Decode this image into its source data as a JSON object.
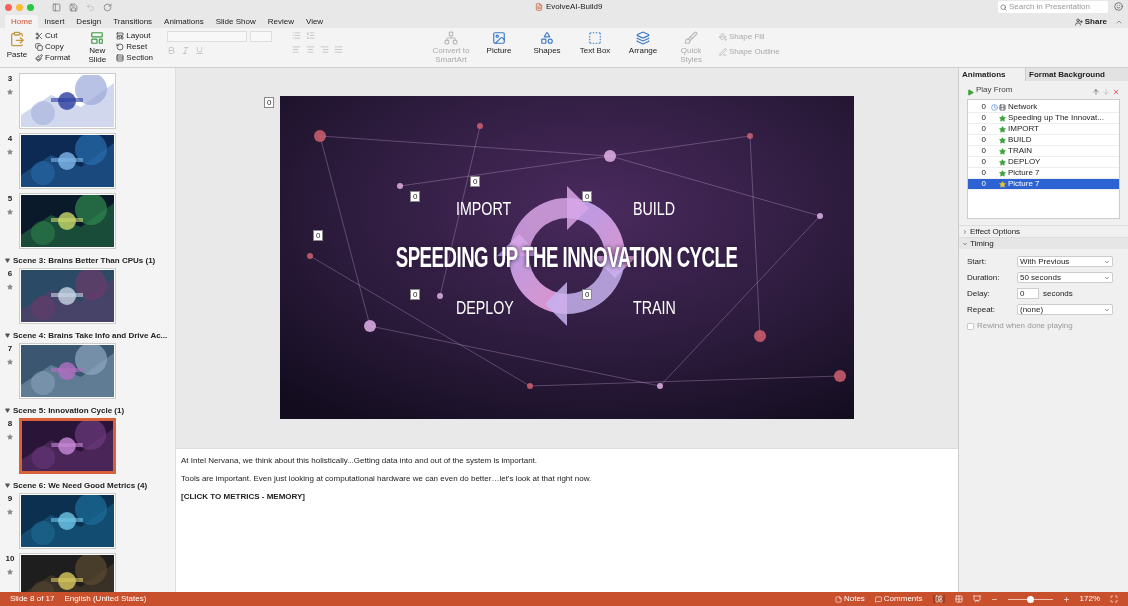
{
  "window": {
    "title": "EvolveAI-Build9"
  },
  "search": {
    "placeholder": "Search in Presentation"
  },
  "share": "Share",
  "tabs": [
    {
      "label": "Home",
      "selected": true
    },
    {
      "label": "Insert",
      "selected": false
    },
    {
      "label": "Design",
      "selected": false
    },
    {
      "label": "Transitions",
      "selected": false
    },
    {
      "label": "Animations",
      "selected": false
    },
    {
      "label": "Slide Show",
      "selected": false
    },
    {
      "label": "Review",
      "selected": false
    },
    {
      "label": "View",
      "selected": false
    }
  ],
  "ribbon": {
    "paste": "Paste",
    "clipboard": [
      "Cut",
      "Copy",
      "Format"
    ],
    "new_slide": "New Slide",
    "slide_tools": [
      "Layout",
      "Reset",
      "Section"
    ],
    "insert": [
      {
        "label": "Convert to SmartArt",
        "kind": "smartart",
        "disabled": true
      },
      {
        "label": "Picture",
        "kind": "picture",
        "disabled": false
      },
      {
        "label": "Shapes",
        "kind": "shapes",
        "disabled": false
      },
      {
        "label": "Text Box",
        "kind": "textbox",
        "disabled": false
      },
      {
        "label": "Arrange",
        "kind": "arrange",
        "disabled": false
      },
      {
        "label": "Quick Styles",
        "kind": "styles",
        "disabled": true
      }
    ],
    "shape_format": [
      "Shape Fill",
      "Shape Outline"
    ]
  },
  "thumbnails": [
    {
      "kind": "slide",
      "number": "3",
      "selected": false
    },
    {
      "kind": "slide",
      "number": "4",
      "selected": false
    },
    {
      "kind": "slide",
      "number": "5",
      "selected": false
    },
    {
      "kind": "section",
      "label": "Scene 3: Brains Better Than CPUs (1)"
    },
    {
      "kind": "slide",
      "number": "6",
      "selected": false
    },
    {
      "kind": "section",
      "label": "Scene 4: Brains Take Info and Drive Ac..."
    },
    {
      "kind": "slide",
      "number": "7",
      "selected": false
    },
    {
      "kind": "section",
      "label": "Scene 5: Innovation Cycle (1)"
    },
    {
      "kind": "slide",
      "number": "8",
      "selected": true
    },
    {
      "kind": "section",
      "label": "Scene 6: We Need Good Metrics (4)"
    },
    {
      "kind": "slide",
      "number": "9",
      "selected": false
    },
    {
      "kind": "slide",
      "number": "10",
      "selected": false
    }
  ],
  "slide": {
    "title": "SPEEDING UP THE INNOVATION CYCLE",
    "labels": [
      "IMPORT",
      "BUILD",
      "DEPLOY",
      "TRAIN"
    ],
    "markers": [
      "0",
      "0",
      "0",
      "0",
      "0",
      "0",
      "0"
    ]
  },
  "notes": [
    {
      "text": "At Intel Nervana, we think about this holistically...Getting data into and out of the system is important.",
      "bold": false
    },
    {
      "text": "Tools are important.  Even just looking at computational hardware we can even do better…let's look at that right now.",
      "bold": false
    },
    {
      "text": "[CLICK TO METRICS - MEMORY]",
      "bold": true
    }
  ],
  "pane": {
    "tabs": [
      {
        "label": "Animations",
        "selected": true
      },
      {
        "label": "Format Background",
        "selected": false
      }
    ],
    "play_from": "Play From",
    "items": [
      {
        "order": "0",
        "name": "Network",
        "kind": "media",
        "selected": false
      },
      {
        "order": "0",
        "name": "Speeding up The Innovat...",
        "kind": "effect",
        "selected": false
      },
      {
        "order": "0",
        "name": "IMPORT",
        "kind": "effect",
        "selected": false
      },
      {
        "order": "0",
        "name": "BUILD",
        "kind": "effect",
        "selected": false
      },
      {
        "order": "0",
        "name": "TRAIN",
        "kind": "effect",
        "selected": false
      },
      {
        "order": "0",
        "name": "DEPLOY",
        "kind": "effect",
        "selected": false
      },
      {
        "order": "0",
        "name": "Picture 7",
        "kind": "effect",
        "selected": false
      },
      {
        "order": "0",
        "name": "Picture 7",
        "kind": "effect",
        "selected": true
      }
    ],
    "effect_options": {
      "label": "Effect Options",
      "expanded": false
    },
    "timing": {
      "label": "Timing",
      "expanded": true,
      "fields": [
        {
          "label": "Start:",
          "value": "With Previous",
          "kind": "select"
        },
        {
          "label": "Duration:",
          "value": "50 seconds",
          "kind": "select"
        },
        {
          "label": "Delay:",
          "value": "0",
          "kind": "stepper",
          "unit": "seconds"
        },
        {
          "label": "Repeat:",
          "value": "(none)",
          "kind": "select"
        }
      ],
      "rewind": {
        "label": "Rewind when done playing",
        "checked": false
      }
    }
  },
  "status": {
    "slide": "Slide 8 of 17",
    "language": "English (United States)",
    "notes": "Notes",
    "comments": "Comments",
    "zoom": "172%",
    "zoom_slider": {
      "level": 0.5
    }
  }
}
